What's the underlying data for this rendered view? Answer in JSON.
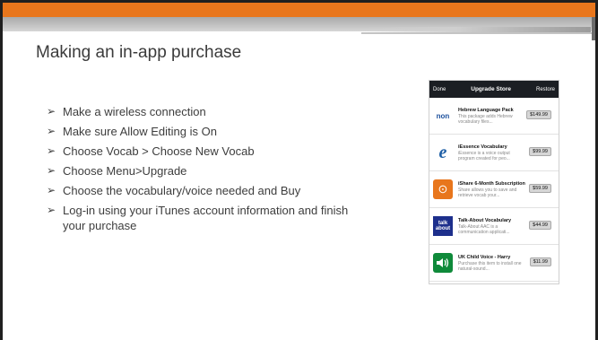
{
  "slide": {
    "title": "Making an in-app purchase",
    "bullets": [
      "Make a wireless connection",
      "Make sure Allow Editing is On",
      "Choose Vocab > Choose New Vocab",
      "Choose Menu>Upgrade",
      "Choose the vocabulary/voice needed and Buy",
      "Log-in using your iTunes account information and finish your purchase"
    ],
    "bullet_marker": "➢"
  },
  "store": {
    "done": "Done",
    "title": "Upgrade Store",
    "restore": "Restore",
    "items": [
      {
        "name": "Hebrew Language Pack",
        "desc": "This package adds Hebrew vocabulary files...",
        "price": "$149.99",
        "icon": "nonfiction-logo-icon",
        "icon_text": "non"
      },
      {
        "name": "iEssence Vocabulary",
        "desc": "iEssence is a voice output program created for peo...",
        "price": "$99.99",
        "icon": "iessence-logo-icon",
        "icon_text": "e"
      },
      {
        "name": "iShare 6-Month Subscription",
        "desc": "Share allows you to save and retrieve vocab your...",
        "price": "$59.99",
        "icon": "ishare-logo-icon",
        "icon_text": "⊙"
      },
      {
        "name": "Talk-About Vocabulary",
        "desc": "Talk-About AAC is a communication applicati...",
        "price": "$44.99",
        "icon": "talk-about-logo-icon",
        "icon_text": "talk about"
      },
      {
        "name": "UK Child Voice - Harry",
        "desc": "Purchase this item to install one natural-sound...",
        "price": "$11.99",
        "icon": "speaker-icon",
        "icon_text": ""
      }
    ]
  },
  "colors": {
    "accent": "#e8761c",
    "nav": "#1b1e23"
  }
}
